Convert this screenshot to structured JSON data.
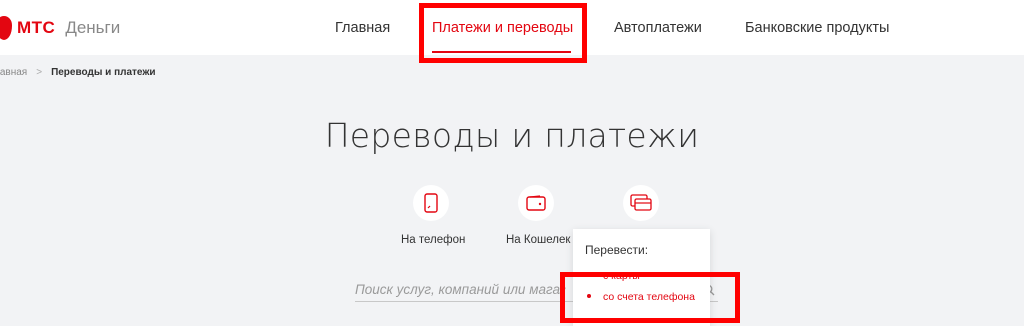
{
  "header": {
    "logo_text": "МТС",
    "logo_sub": "Деньги",
    "nav": [
      {
        "label": "Главная"
      },
      {
        "label": "Платежи и переводы"
      },
      {
        "label": "Автоплатежи"
      },
      {
        "label": "Банковские продукты"
      }
    ],
    "active_nav": "Платежи и переводы"
  },
  "breadcrumb": {
    "home": "лавная",
    "separator": ">",
    "current": "Переводы и платежи"
  },
  "page": {
    "title": "Переводы и платежи"
  },
  "options": [
    {
      "label": "На телефон",
      "icon": "phone-icon"
    },
    {
      "label": "На Кошелек",
      "icon": "wallet-icon"
    },
    {
      "label": "",
      "icon": "cards-icon"
    }
  ],
  "search": {
    "placeholder": "Поиск услуг, компаний или магаз"
  },
  "dropdown": {
    "title": "Перевести:",
    "items": [
      {
        "label": "с карты"
      },
      {
        "label": "со счета телефона"
      }
    ]
  },
  "colors": {
    "brand_red": "#e30611",
    "annotation_red": "#ff0000",
    "background": "#f2f3f5"
  }
}
